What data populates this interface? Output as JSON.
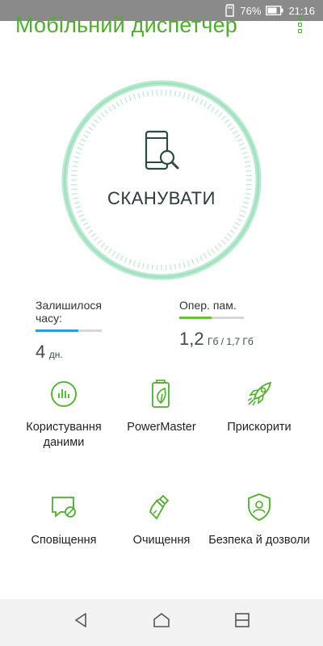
{
  "status_bar": {
    "battery_percent": "76%",
    "time": "21:16",
    "icons": [
      "sd-card-icon",
      "battery-icon"
    ]
  },
  "header": {
    "title": "Мобільний диспетчер",
    "menu_icon": "more-options-icon"
  },
  "scan": {
    "label": "СКАНУВАТИ",
    "icon": "phone-search-icon"
  },
  "stats": {
    "time_left": {
      "label": "Залишилося часу:",
      "value": "4",
      "unit": "дн.",
      "fill_fraction": 0.65,
      "color": "#2aa0d8"
    },
    "ram": {
      "label": "Опер. пам.",
      "value": "1,2",
      "unit": "Гб / 1,7 Гб",
      "fill_fraction": 0.5,
      "color": "#6cbf3a"
    }
  },
  "tiles": [
    {
      "label": "Користування даними",
      "icon": "data-usage-icon"
    },
    {
      "label": "PowerMaster",
      "icon": "battery-leaf-icon"
    },
    {
      "label": "Прискорити",
      "icon": "rocket-icon"
    },
    {
      "label": "Сповіщення",
      "icon": "notification-block-icon"
    },
    {
      "label": "Очищення",
      "icon": "broom-icon"
    },
    {
      "label": "Безпека й дозволи",
      "icon": "security-shield-icon"
    }
  ],
  "colors": {
    "accent": "#4caf2a",
    "ring": "#9fdfb8",
    "nav_bg": "#f2f2f2"
  },
  "nav": {
    "back": "back-icon",
    "home": "home-icon",
    "recents": "recents-icon"
  }
}
